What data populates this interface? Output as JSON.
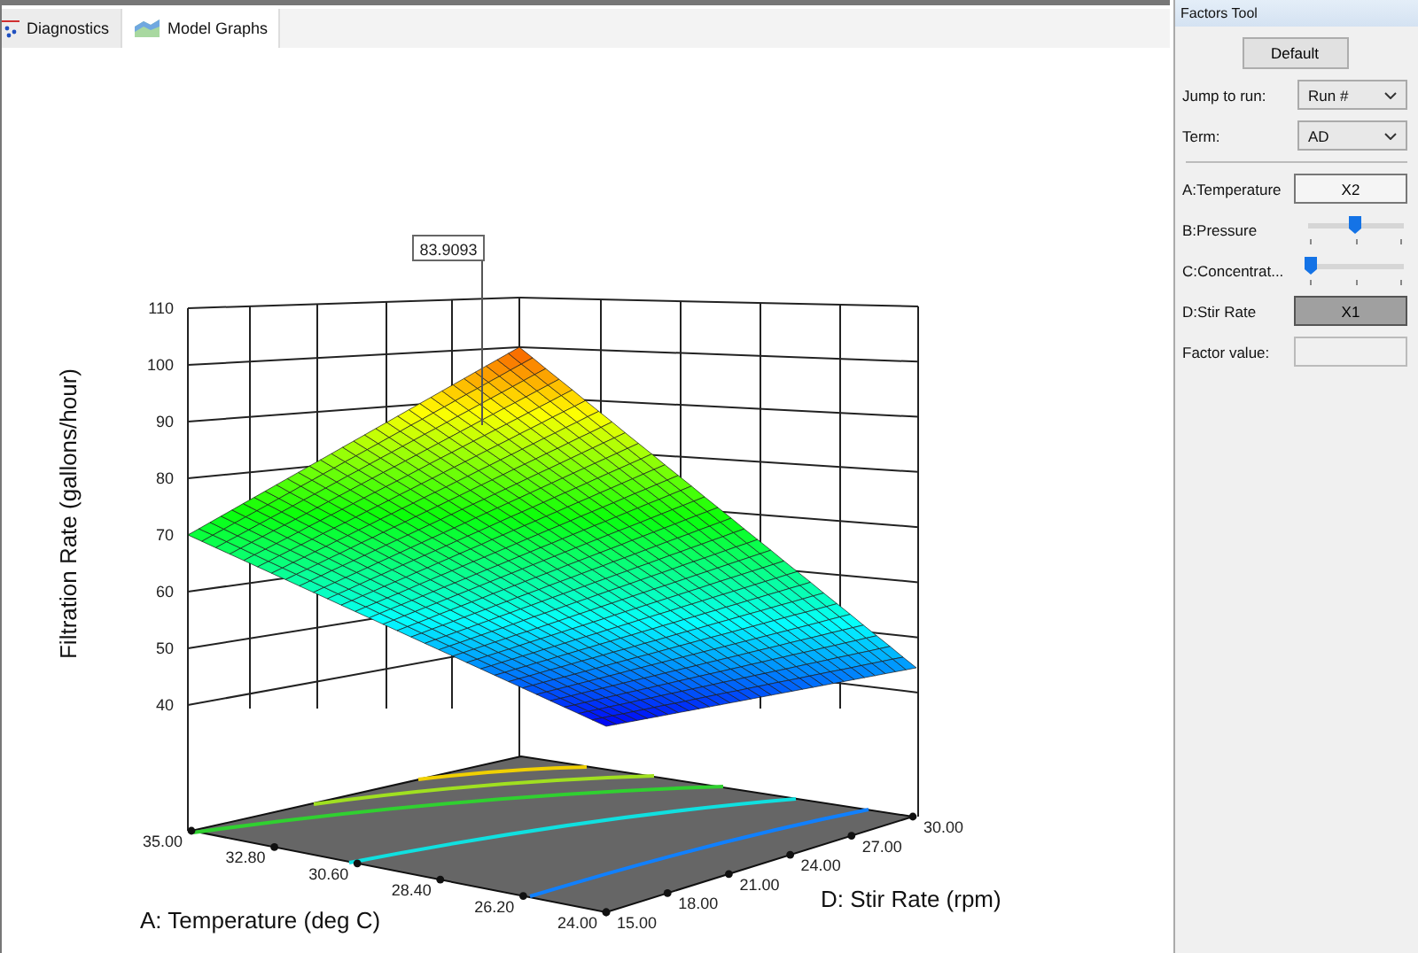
{
  "tabs": [
    {
      "label": "Diagnostics",
      "selected": false
    },
    {
      "label": "Model Graphs",
      "selected": true
    }
  ],
  "graph": {
    "callout": "83.9093",
    "y_axis_title": "Filtration Rate (gallons/hour)",
    "y_ticks": [
      "110",
      "100",
      "90",
      "80",
      "70",
      "60",
      "50",
      "40"
    ],
    "x_axis_title": "A: Temperature (deg C)",
    "x_ticks": [
      "35.00",
      "32.80",
      "30.60",
      "28.40",
      "26.20",
      "24.00"
    ],
    "depth_axis_title": "D: Stir Rate (rpm)",
    "depth_ticks": [
      "15.00",
      "18.00",
      "21.00",
      "24.00",
      "27.00",
      "30.00"
    ]
  },
  "factors_tool": {
    "title": "Factors Tool",
    "default_button": "Default",
    "jump_to_run": {
      "label": "Jump to run:",
      "value": "Run #"
    },
    "term": {
      "label": "Term:",
      "value": "AD"
    },
    "factors": [
      {
        "kind": "axis",
        "label": "A:Temperature",
        "value": "X2",
        "selected": false
      },
      {
        "kind": "slider",
        "label": "B:Pressure",
        "level": 0.5
      },
      {
        "kind": "slider",
        "label": "C:Concentrat...",
        "level": 0
      },
      {
        "kind": "axis",
        "label": "D:Stir Rate",
        "value": "X1",
        "selected": true
      }
    ],
    "factor_value": {
      "label": "Factor value:"
    }
  }
}
